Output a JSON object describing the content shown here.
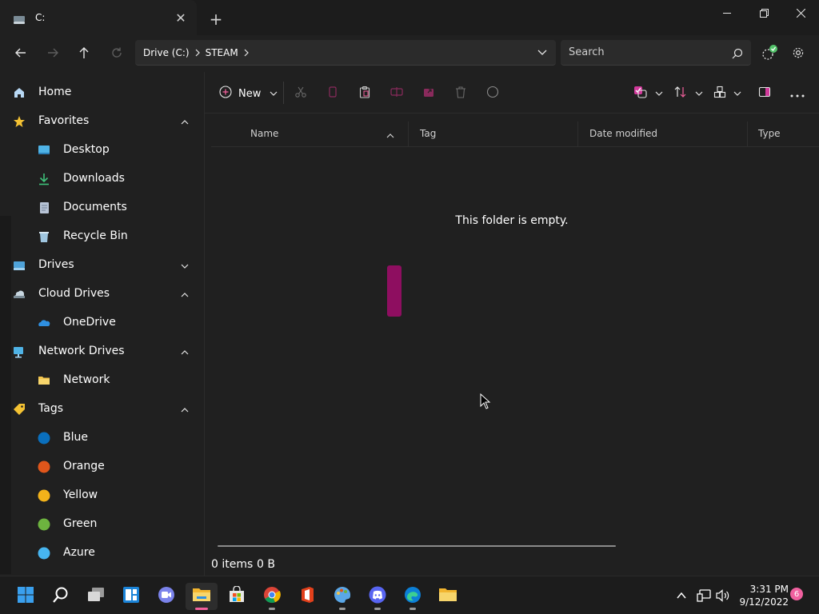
{
  "tab": {
    "title": "C:",
    "close_glyph": "✕"
  },
  "newtab_glyph": "+",
  "window_controls": [
    "minimize-icon",
    "restore-icon",
    "close-icon"
  ],
  "address": {
    "crumbs": [
      "Drive (C:)",
      "STEAM"
    ]
  },
  "search": {
    "placeholder": "Search"
  },
  "sidebar": {
    "items": [
      {
        "label": "Home",
        "icon": "home-icon"
      },
      {
        "label": "Favorites",
        "icon": "star-icon",
        "expanded": true
      },
      {
        "label": "Desktop",
        "icon": "desktop-icon"
      },
      {
        "label": "Downloads",
        "icon": "download-icon"
      },
      {
        "label": "Documents",
        "icon": "documents-icon"
      },
      {
        "label": "Recycle Bin",
        "icon": "recycle-bin-icon"
      },
      {
        "label": "Drives",
        "icon": "drive-icon",
        "expanded": false
      },
      {
        "label": "Cloud Drives",
        "icon": "cloud-drive-icon",
        "expanded": true
      },
      {
        "label": "OneDrive",
        "icon": "onedrive-icon"
      },
      {
        "label": "Network Drives",
        "icon": "network-drive-icon",
        "expanded": true
      },
      {
        "label": "Network",
        "icon": "folder-icon"
      },
      {
        "label": "Tags",
        "icon": "tag-icon",
        "expanded": true
      },
      {
        "label": "Blue",
        "color": "#0a6fbd"
      },
      {
        "label": "Orange",
        "color": "#e0561b"
      },
      {
        "label": "Yellow",
        "color": "#f2b21a"
      },
      {
        "label": "Green",
        "color": "#6db33f"
      },
      {
        "label": "Azure",
        "color": "#47b5f0"
      }
    ]
  },
  "toolbar": {
    "new_label": "New"
  },
  "columns": [
    "Name",
    "Tag",
    "Date modified",
    "Type"
  ],
  "content": {
    "empty_message": "This folder is empty."
  },
  "status": {
    "items": "0 items",
    "size": "0 B"
  },
  "taskbar": {
    "time": "3:31 PM",
    "date": "9/12/2022",
    "notification_count": "6"
  },
  "colors": {
    "accent": "#f2609c",
    "background": "#202020"
  }
}
